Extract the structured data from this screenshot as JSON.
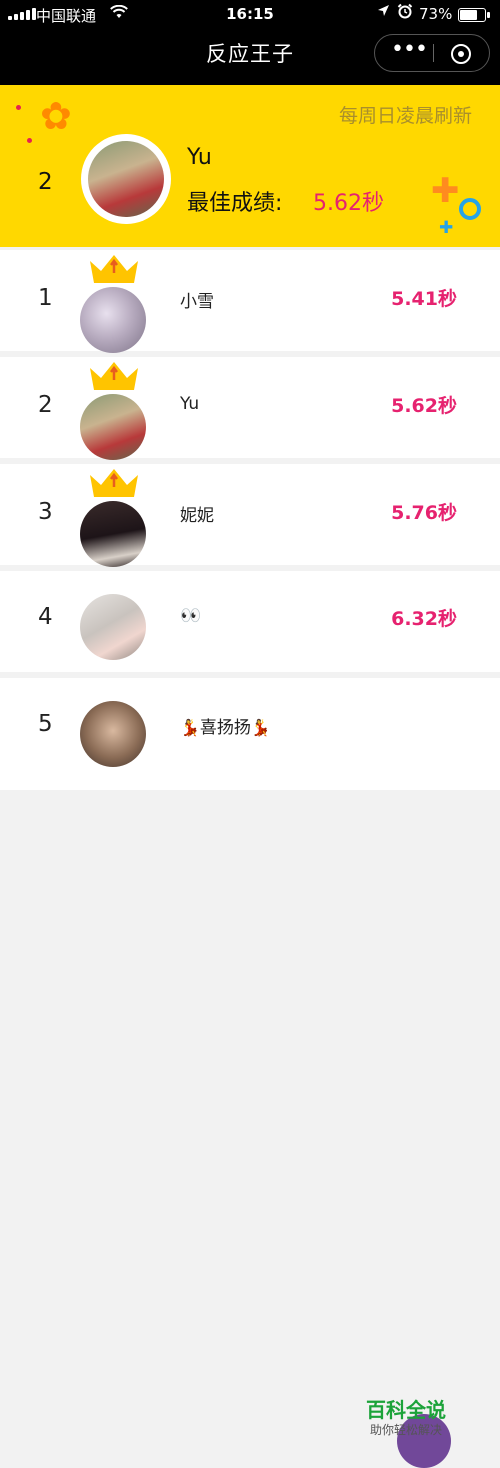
{
  "status_bar": {
    "carrier": "中国联通",
    "time": "16:15",
    "battery": "73%",
    "battery_level": 0.73
  },
  "nav": {
    "title": "反应王子",
    "more_label": "•••"
  },
  "banner": {
    "refresh_note": "每周日凌晨刷新",
    "rank": "2",
    "name": "Yu",
    "score_label": "最佳成绩:",
    "score": "5.62秒",
    "accent_orange": "#ff8a00",
    "accent_blue": "#26a3e8"
  },
  "leaderboard": [
    {
      "rank": "1",
      "name": "小雪",
      "score": "5.41秒",
      "crown": true
    },
    {
      "rank": "2",
      "name": "Yu",
      "score": "5.62秒",
      "crown": true
    },
    {
      "rank": "3",
      "name": "妮妮",
      "score": "5.76秒",
      "crown": true
    },
    {
      "rank": "4",
      "name": "👀",
      "score": "6.32秒",
      "crown": false
    },
    {
      "rank": "5",
      "name": "喜扬扬",
      "score": "",
      "crown": false
    }
  ],
  "watermark": {
    "title": "百科全说",
    "subtitle": "助你轻松解决"
  },
  "colors": {
    "banner_bg": "#ffd800",
    "score_pink": "#e6226f",
    "crown_gold": "#ffc400"
  }
}
